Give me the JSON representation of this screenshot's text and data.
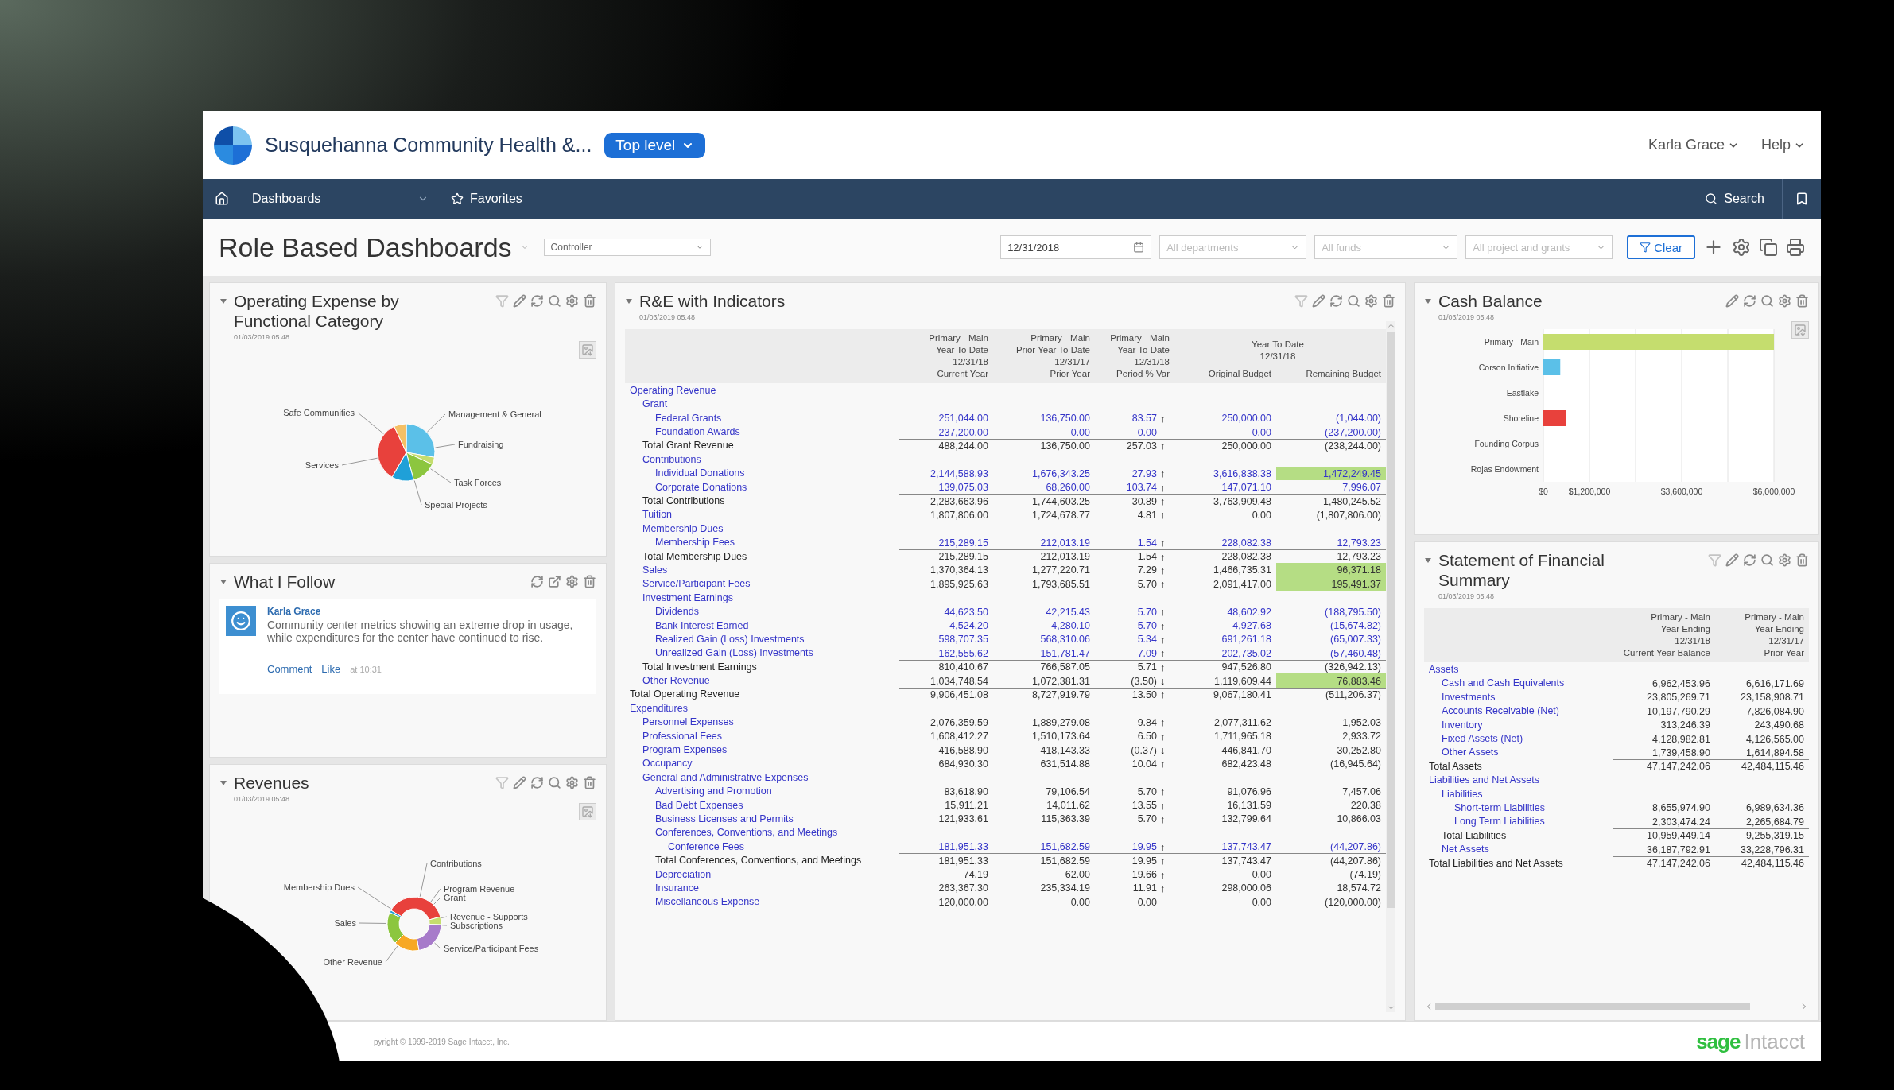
{
  "header": {
    "org_name": "Susquehanna Community Health &...",
    "level": "Top level",
    "user": "Karla Grace",
    "help": "Help"
  },
  "nav": {
    "items": [
      {
        "label": "Dashboards",
        "kind": "menu"
      },
      {
        "label": "Favorites",
        "kind": "favorites"
      }
    ],
    "search": "Search"
  },
  "toolbar": {
    "title": "Role Based Dashboards",
    "role": "Controller",
    "date": "12/31/2018",
    "filters": [
      {
        "placeholder": "All departments"
      },
      {
        "placeholder": "All funds"
      },
      {
        "placeholder": "All project and grants"
      }
    ],
    "clear": "Clear"
  },
  "columns": [
    {
      "widgets": [
        {
          "kind": "pie",
          "title": "Operating Expense by Functional Category",
          "timestamp": "01/03/2019 05:48",
          "labels": [
            "Safe Communities",
            "Management & General",
            "Fundraising",
            "Services",
            "Task Forces",
            "Special Projects"
          ]
        },
        {
          "kind": "feed",
          "title": "What I Follow",
          "posts": [
            {
              "author": "Karla Grace",
              "text": "Community center metrics showing an extreme drop in usage, while expenditures for the center have continued to rise.",
              "actions": [
                "Comment",
                "Like"
              ],
              "time": "at 10:31"
            }
          ]
        },
        {
          "kind": "donut",
          "title": "Revenues",
          "timestamp": "01/03/2019 05:48",
          "labels": [
            "Contributions",
            "Membership Dues",
            "Program Revenue",
            "Grant",
            "Sales",
            "Revenue - Supports",
            "Subscriptions",
            "Service/Participant Fees",
            "Other Revenue"
          ]
        }
      ]
    },
    {
      "widgets": [
        {
          "kind": "report",
          "title": "R&E with Indicators",
          "timestamp": "01/03/2019 05:48",
          "columns": [
            "Primary - Main\nYear To Date\n12/31/18\nCurrent Year",
            "Primary - Main\nPrior Year To Date\n12/31/17\nPrior Year",
            "Primary - Main\nYear To Date\n12/31/18\nPeriod % Var",
            "Original Budget",
            "Remaining Budget"
          ],
          "column_group": "Year To Date\n12/31/18",
          "rows": [
            {
              "label": "Operating Revenue",
              "kind": "group",
              "flagged": false,
              "children": [
                {
                  "label": "Grant",
                  "kind": "group",
                  "flagged": false,
                  "children": [
                    {
                      "label": "Federal Grants",
                      "kind": "detail",
                      "values": [
                        "251,044.00",
                        "136,750.00",
                        "83.57",
                        "250,000.00",
                        "(1,044.00)"
                      ],
                      "trend": "↑",
                      "flagged": false
                    },
                    {
                      "label": "Foundation Awards",
                      "kind": "detail",
                      "values": [
                        "237,200.00",
                        "0.00",
                        "0.00",
                        "0.00",
                        "(237,200.00)"
                      ],
                      "flagged": false
                    }
                  ]
                },
                {
                  "label": "Total Grant Revenue",
                  "kind": "total",
                  "values": [
                    "488,244.00",
                    "136,750.00",
                    "257.03",
                    "250,000.00",
                    "(238,244.00)"
                  ],
                  "trend": "↑",
                  "flagged": false
                },
                {
                  "label": "Contributions",
                  "kind": "group",
                  "flagged": false,
                  "children": [
                    {
                      "label": "Individual Donations",
                      "kind": "detail",
                      "values": [
                        "2,144,588.93",
                        "1,676,343.25",
                        "27.93",
                        "3,616,838.38",
                        "1,472,249.45"
                      ],
                      "trend": "↑",
                      "flagged": true
                    },
                    {
                      "label": "Corporate Donations",
                      "kind": "detail",
                      "values": [
                        "139,075.03",
                        "68,260.00",
                        "103.74",
                        "147,071.10",
                        "7,996.07"
                      ],
                      "trend": "↑",
                      "flagged": false
                    }
                  ]
                },
                {
                  "label": "Total Contributions",
                  "kind": "total",
                  "values": [
                    "2,283,663.96",
                    "1,744,603.25",
                    "30.89",
                    "3,763,909.48",
                    "1,480,245.52"
                  ],
                  "trend": "↑",
                  "flagged": false
                },
                {
                  "label": "Tuition",
                  "kind": "account",
                  "values": [
                    "1,807,806.00",
                    "1,724,678.77",
                    "4.81",
                    "0.00",
                    "(1,807,806.00)"
                  ],
                  "trend": "↑",
                  "flagged": false
                },
                {
                  "label": "Membership Dues",
                  "kind": "group",
                  "flagged": false,
                  "children": [
                    {
                      "label": "Membership Fees",
                      "kind": "detail",
                      "values": [
                        "215,289.15",
                        "212,013.19",
                        "1.54",
                        "228,082.38",
                        "12,793.23"
                      ],
                      "trend": "↑",
                      "flagged": false
                    }
                  ]
                },
                {
                  "label": "Total Membership Dues",
                  "kind": "total",
                  "values": [
                    "215,289.15",
                    "212,013.19",
                    "1.54",
                    "228,082.38",
                    "12,793.23"
                  ],
                  "trend": "↑",
                  "flagged": false
                },
                {
                  "label": "Sales",
                  "kind": "account",
                  "values": [
                    "1,370,364.13",
                    "1,277,220.71",
                    "7.29",
                    "1,466,735.31",
                    "96,371.18"
                  ],
                  "trend": "↑",
                  "flagged": true
                },
                {
                  "label": "Service/Participant Fees",
                  "kind": "account",
                  "values": [
                    "1,895,925.63",
                    "1,793,685.51",
                    "5.70",
                    "2,091,417.00",
                    "195,491.37"
                  ],
                  "trend": "↑",
                  "flagged": true
                },
                {
                  "label": "Investment Earnings",
                  "kind": "group",
                  "flagged": false,
                  "children": [
                    {
                      "label": "Dividends",
                      "kind": "detail",
                      "values": [
                        "44,623.50",
                        "42,215.43",
                        "5.70",
                        "48,602.92",
                        "(188,795.50)"
                      ],
                      "trend": "↑",
                      "flagged": false
                    },
                    {
                      "label": "Bank Interest Earned",
                      "kind": "detail",
                      "values": [
                        "4,524.20",
                        "4,280.10",
                        "5.70",
                        "4,927.68",
                        "(15,674.82)"
                      ],
                      "trend": "↑",
                      "flagged": false
                    },
                    {
                      "label": "Realized Gain (Loss) Investments",
                      "kind": "detail",
                      "values": [
                        "598,707.35",
                        "568,310.06",
                        "5.34",
                        "691,261.18",
                        "(65,007.33)"
                      ],
                      "trend": "↑",
                      "flagged": false
                    },
                    {
                      "label": "Unrealized Gain (Loss) Investments",
                      "kind": "detail",
                      "values": [
                        "162,555.62",
                        "151,781.47",
                        "7.09",
                        "202,735.02",
                        "(57,460.48)"
                      ],
                      "trend": "↑",
                      "flagged": false
                    }
                  ]
                },
                {
                  "label": "Total Investment Earnings",
                  "kind": "total",
                  "values": [
                    "810,410.67",
                    "766,587.05",
                    "5.71",
                    "947,526.80",
                    "(326,942.13)"
                  ],
                  "trend": "↑",
                  "flagged": false
                },
                {
                  "label": "Other Revenue",
                  "kind": "account",
                  "values": [
                    "1,034,748.54",
                    "1,072,381.31",
                    "(3.50)",
                    "1,119,609.44",
                    "76,883.46"
                  ],
                  "trend": "↓",
                  "flagged": true
                }
              ]
            },
            {
              "label": "Total Operating Revenue",
              "kind": "total",
              "values": [
                "9,906,451.08",
                "8,727,919.79",
                "13.50",
                "9,067,180.41",
                "(511,206.37)"
              ],
              "trend": "↑",
              "flagged": false
            },
            {
              "label": "Expenditures",
              "kind": "group",
              "flagged": false,
              "children": [
                {
                  "label": "Personnel Expenses",
                  "kind": "account",
                  "values": [
                    "2,076,359.59",
                    "1,889,279.08",
                    "9.84",
                    "2,077,311.62",
                    "1,952.03"
                  ],
                  "trend": "↑",
                  "flagged": false
                },
                {
                  "label": "Professional Fees",
                  "kind": "account",
                  "values": [
                    "1,608,412.27",
                    "1,510,173.64",
                    "6.50",
                    "1,711,965.18",
                    "2,933.72"
                  ],
                  "trend": "↑",
                  "flagged": false
                },
                {
                  "label": "Program Expenses",
                  "kind": "account",
                  "values": [
                    "416,588.90",
                    "418,143.33",
                    "(0.37)",
                    "446,841.70",
                    "30,252.80"
                  ],
                  "trend": "↓",
                  "flagged": false
                },
                {
                  "label": "Occupancy",
                  "kind": "account",
                  "values": [
                    "684,930.30",
                    "631,514.88",
                    "10.04",
                    "682,423.48",
                    "(16,945.64)"
                  ],
                  "trend": "↑",
                  "flagged": false
                },
                {
                  "label": "General and Administrative Expenses",
                  "kind": "group",
                  "flagged": false,
                  "children": [
                    {
                      "label": "Advertising and Promotion",
                      "kind": "account",
                      "values": [
                        "83,618.90",
                        "79,106.54",
                        "5.70",
                        "91,076.96",
                        "7,457.06"
                      ],
                      "trend": "↑",
                      "flagged": false
                    },
                    {
                      "label": "Bad Debt Expenses",
                      "kind": "account",
                      "values": [
                        "15,911.21",
                        "14,011.62",
                        "13.55",
                        "16,131.59",
                        "220.38"
                      ],
                      "trend": "↑",
                      "flagged": false
                    },
                    {
                      "label": "Business Licenses and Permits",
                      "kind": "account",
                      "values": [
                        "121,933.61",
                        "115,363.39",
                        "5.70",
                        "132,799.64",
                        "10,866.03"
                      ],
                      "trend": "↑",
                      "flagged": false
                    },
                    {
                      "label": "Conferences, Conventions, and Meetings",
                      "kind": "group",
                      "flagged": false,
                      "children": [
                        {
                          "label": "Conference Fees",
                          "kind": "detail",
                          "values": [
                            "181,951.33",
                            "151,682.59",
                            "19.95",
                            "137,743.47",
                            "(44,207.86)"
                          ],
                          "trend": "↑",
                          "flagged": false
                        }
                      ]
                    },
                    {
                      "label": "Total Conferences, Conventions, and Meetings",
                      "kind": "total",
                      "values": [
                        "181,951.33",
                        "151,682.59",
                        "19.95",
                        "137,743.47",
                        "(44,207.86)"
                      ],
                      "trend": "↑",
                      "flagged": false
                    },
                    {
                      "label": "Depreciation",
                      "kind": "account",
                      "values": [
                        "74.19",
                        "62.00",
                        "19.66",
                        "0.00",
                        "(74.19)"
                      ],
                      "trend": "↑",
                      "flagged": false
                    },
                    {
                      "label": "Insurance",
                      "kind": "account",
                      "values": [
                        "263,367.30",
                        "235,334.19",
                        "11.91",
                        "298,000.06",
                        "18,574.72"
                      ],
                      "trend": "↑",
                      "flagged": false
                    },
                    {
                      "label": "Miscellaneous Expense",
                      "kind": "account",
                      "values": [
                        "120,000.00",
                        "0.00",
                        "0.00",
                        "0.00",
                        "(120,000.00)"
                      ],
                      "flagged": false
                    }
                  ]
                }
              ]
            }
          ]
        }
      ]
    },
    {
      "widgets": [
        {
          "kind": "bar",
          "title": "Cash Balance",
          "timestamp": "01/03/2019 05:48",
          "chart_data": {
            "type": "bar",
            "orientation": "horizontal",
            "categories": [
              "Primary - Main",
              "Corson Initiative",
              "Eastlake",
              "Shoreline",
              "Founding Corpus",
              "Rojas Endowment"
            ],
            "values": [
              6000000,
              440000,
              0,
              590000,
              0,
              0
            ],
            "colors": [
              "#c5dd6e",
              "#5bc0e8",
              "#c5dd6e",
              "#e8413c",
              "#c5dd6e",
              "#c5dd6e"
            ],
            "xlim": [
              0,
              6000000
            ],
            "xticks": [
              {
                "value": 0,
                "label": "$0"
              },
              {
                "value": 1200000,
                "label": "$1,200,000"
              },
              {
                "value": 3600000,
                "label": "$3,600,000"
              },
              {
                "value": 6000000,
                "label": "$6,000,000"
              }
            ]
          }
        },
        {
          "kind": "statement",
          "title": "Statement of Financial Summary",
          "timestamp": "01/03/2019 05:48",
          "columns": [
            "Primary - Main\nYear Ending\n12/31/18\nCurrent Year Balance",
            "Primary - Main\nYear Ending\n12/31/17\nPrior Year"
          ],
          "rows": [
            {
              "label": "Assets",
              "kind": "group",
              "children": [
                {
                  "label": "Cash and Cash Equivalents",
                  "kind": "account",
                  "values": [
                    "6,962,453.96",
                    "6,616,171.69"
                  ]
                },
                {
                  "label": "Investments",
                  "kind": "account",
                  "values": [
                    "23,805,269.71",
                    "23,158,908.71"
                  ]
                },
                {
                  "label": "Accounts Receivable (Net)",
                  "kind": "account",
                  "values": [
                    "10,197,790.29",
                    "7,826,084.90"
                  ]
                },
                {
                  "label": "Inventory",
                  "kind": "account",
                  "values": [
                    "313,246.39",
                    "243,490.68"
                  ]
                },
                {
                  "label": "Fixed Assets (Net)",
                  "kind": "account",
                  "values": [
                    "4,128,982.81",
                    "4,126,565.00"
                  ]
                },
                {
                  "label": "Other Assets",
                  "kind": "account",
                  "values": [
                    "1,739,458.90",
                    "1,614,894.58"
                  ]
                }
              ]
            },
            {
              "label": "Total Assets",
              "kind": "total",
              "values": [
                "47,147,242.06",
                "42,484,115.46"
              ]
            },
            {
              "label": "Liabilities and Net Assets",
              "kind": "group",
              "children": [
                {
                  "label": "Liabilities",
                  "kind": "group",
                  "children": [
                    {
                      "label": "Short-term Liabilities",
                      "kind": "account",
                      "values": [
                        "8,655,974.90",
                        "6,989,634.36"
                      ]
                    },
                    {
                      "label": "Long Term Liabilities",
                      "kind": "account",
                      "values": [
                        "2,303,474.24",
                        "2,265,684.79"
                      ]
                    }
                  ]
                },
                {
                  "label": "Total Liabilities",
                  "kind": "total",
                  "values": [
                    "10,959,449.14",
                    "9,255,319.15"
                  ]
                },
                {
                  "label": "Net Assets",
                  "kind": "account",
                  "values": [
                    "36,187,792.91",
                    "33,228,796.31"
                  ]
                }
              ]
            },
            {
              "label": "Total Liabilities and Net Assets",
              "kind": "total",
              "values": [
                "47,147,242.06",
                "42,484,115.46"
              ]
            }
          ]
        }
      ]
    }
  ],
  "footer": {
    "copyright": "pyright © 1999-2019 Sage Intacct, Inc.",
    "logo": {
      "brand": "sage",
      "product": "Intacct"
    }
  }
}
